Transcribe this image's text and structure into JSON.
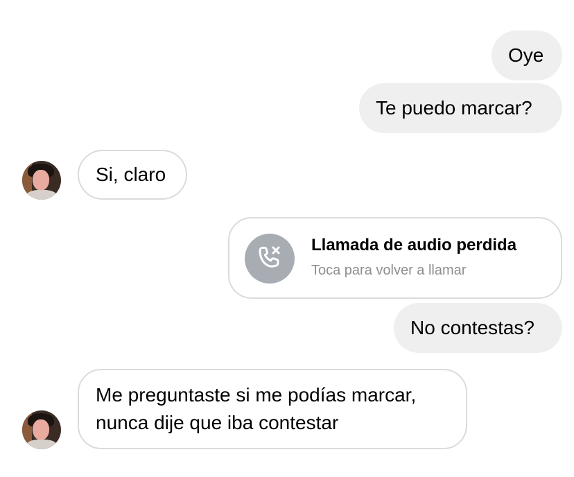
{
  "messages": [
    {
      "direction": "outgoing",
      "text": "Oye"
    },
    {
      "direction": "outgoing",
      "text": "Te puedo marcar?"
    },
    {
      "direction": "incoming",
      "text": "Si, claro"
    },
    {
      "direction": "outgoing",
      "type": "missed-call",
      "title": "Llamada de audio perdida",
      "subtitle": "Toca para volver a llamar"
    },
    {
      "direction": "outgoing",
      "text": "No contestas?"
    },
    {
      "direction": "incoming",
      "lines": [
        "Me preguntaste si me podías marcar,",
        "nunca dije que iba contestar"
      ]
    }
  ],
  "colors": {
    "outgoing_bubble": "#efefef",
    "incoming_border": "#dbdbdb",
    "missed_call_icon_bg": "#a8acb3",
    "subtitle_text": "#8e8e8e"
  },
  "icons": {
    "missed_call": "phone-x-icon",
    "avatar": "contact-avatar"
  }
}
